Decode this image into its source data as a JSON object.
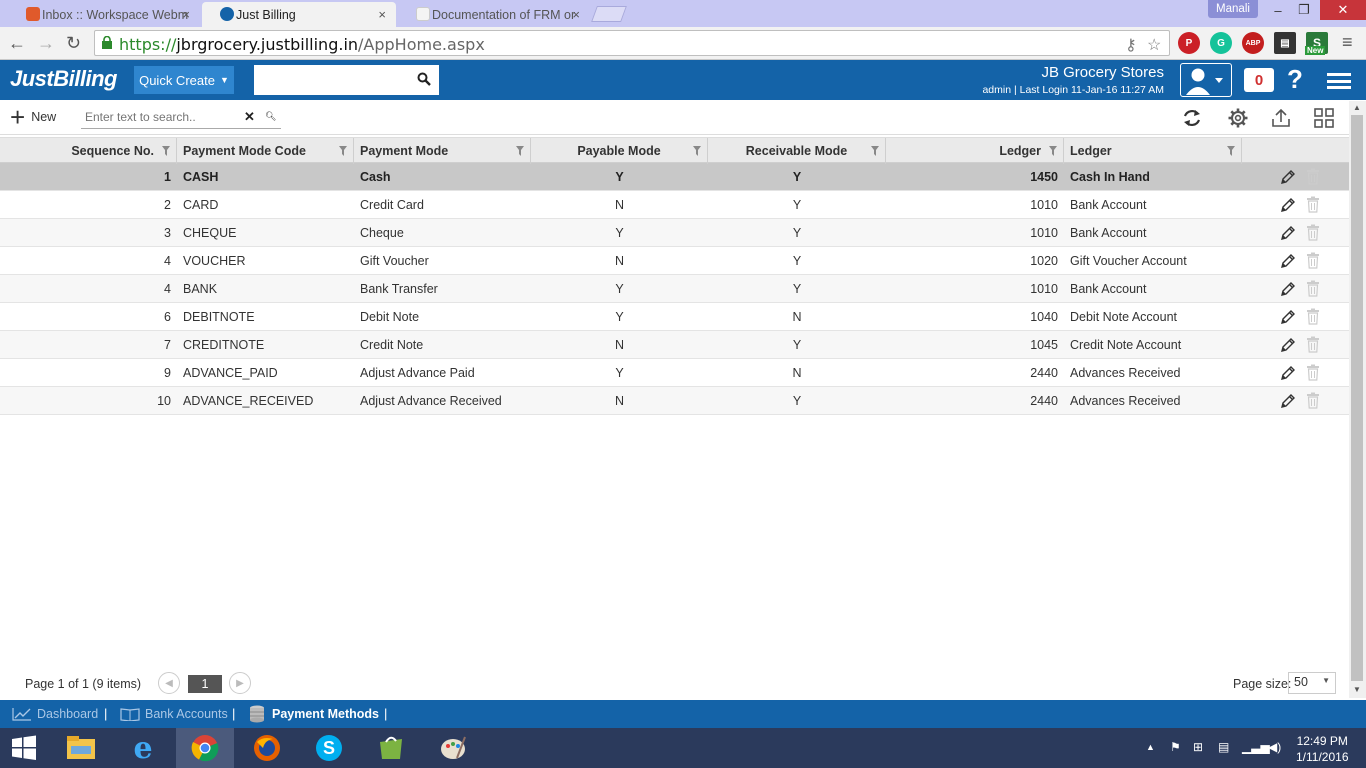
{
  "browser": {
    "tabs": [
      {
        "title": "Inbox :: Workspace Webm",
        "active": false
      },
      {
        "title": "Just Billing",
        "active": true
      },
      {
        "title": "Documentation of FRM or",
        "active": false
      }
    ],
    "user_profile": "Manali",
    "url_scheme": "https://",
    "url_host": "jbrgrocery.justbilling.in",
    "url_path": "/AppHome.aspx",
    "extension_badge": "New"
  },
  "header": {
    "logo": "JustBilling",
    "quick_create_label": "Quick Create",
    "search_value": "",
    "store_name": "JB Grocery Stores",
    "login_info": "admin | Last Login 11-Jan-16 11:27 AM",
    "notification_count": "0",
    "help_label": "?"
  },
  "toolbar": {
    "new_label": "New",
    "search_placeholder": "Enter text to search.."
  },
  "grid": {
    "columns": [
      "Sequence No.",
      "Payment Mode Code",
      "Payment Mode",
      "Payable Mode",
      "Receivable Mode",
      "Ledger",
      "Ledger"
    ],
    "rows": [
      {
        "seq": "1",
        "code": "CASH",
        "mode": "Cash",
        "payable": "Y",
        "receivable": "Y",
        "ledger_no": "1450",
        "ledger_name": "Cash In Hand"
      },
      {
        "seq": "2",
        "code": "CARD",
        "mode": "Credit Card",
        "payable": "N",
        "receivable": "Y",
        "ledger_no": "1010",
        "ledger_name": "Bank Account"
      },
      {
        "seq": "3",
        "code": "CHEQUE",
        "mode": "Cheque",
        "payable": "Y",
        "receivable": "Y",
        "ledger_no": "1010",
        "ledger_name": "Bank Account"
      },
      {
        "seq": "4",
        "code": "VOUCHER",
        "mode": "Gift Voucher",
        "payable": "N",
        "receivable": "Y",
        "ledger_no": "1020",
        "ledger_name": "Gift Voucher Account"
      },
      {
        "seq": "4",
        "code": "BANK",
        "mode": "Bank Transfer",
        "payable": "Y",
        "receivable": "Y",
        "ledger_no": "1010",
        "ledger_name": "Bank Account"
      },
      {
        "seq": "6",
        "code": "DEBITNOTE",
        "mode": "Debit Note",
        "payable": "Y",
        "receivable": "N",
        "ledger_no": "1040",
        "ledger_name": "Debit Note Account"
      },
      {
        "seq": "7",
        "code": "CREDITNOTE",
        "mode": "Credit Note",
        "payable": "N",
        "receivable": "Y",
        "ledger_no": "1045",
        "ledger_name": "Credit Note Account"
      },
      {
        "seq": "9",
        "code": "ADVANCE_PAID",
        "mode": "Adjust Advance Paid",
        "payable": "Y",
        "receivable": "N",
        "ledger_no": "2440",
        "ledger_name": "Advances Received"
      },
      {
        "seq": "10",
        "code": "ADVANCE_RECEIVED",
        "mode": "Adjust Advance Received",
        "payable": "N",
        "receivable": "Y",
        "ledger_no": "2440",
        "ledger_name": "Advances Received"
      }
    ]
  },
  "pager": {
    "info": "Page 1 of 1 (9 items)",
    "current_page": "1",
    "page_size_label": "Page size:",
    "page_size": "50"
  },
  "footer": {
    "items": [
      {
        "label": "Dashboard",
        "active": false
      },
      {
        "label": "Bank Accounts",
        "active": false
      },
      {
        "label": "Payment Methods",
        "active": true
      }
    ]
  },
  "taskbar": {
    "time": "12:49 PM",
    "date": "1/11/2016"
  },
  "colors": {
    "header_blue": "#1463a8",
    "quick_create_blue": "#2f86cf",
    "selected_row": "#c8c8c8",
    "tabstrip": "#c7c8f3"
  }
}
